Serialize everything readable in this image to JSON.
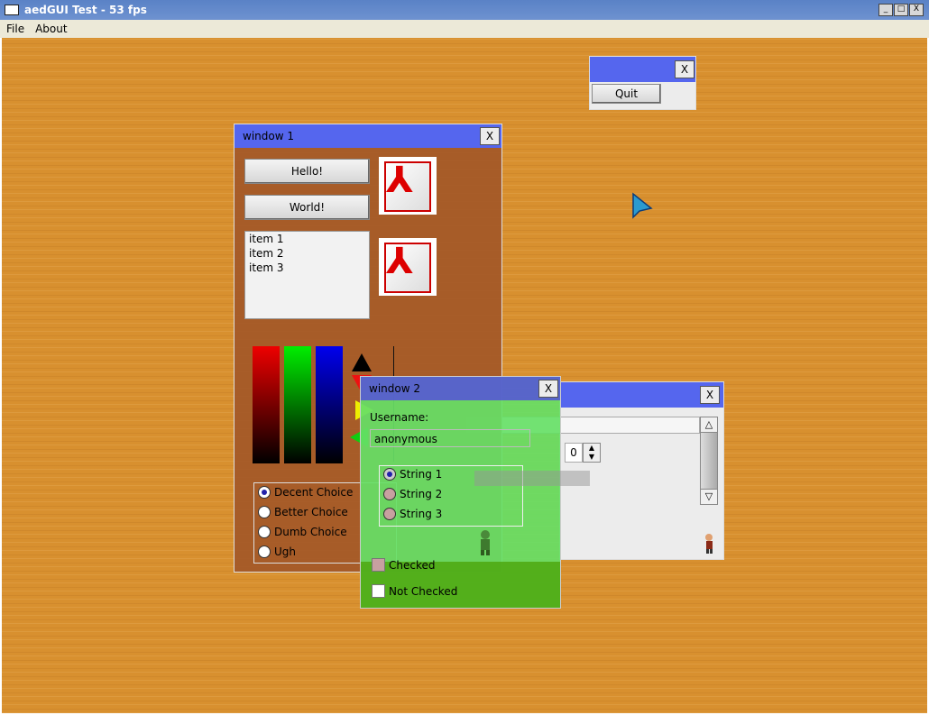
{
  "app": {
    "title": "aedGUI Test - 53 fps",
    "controls": [
      "_",
      "□",
      "X"
    ]
  },
  "menu": [
    "File",
    "About"
  ],
  "quit_window": {
    "close": "X",
    "quit": "Quit"
  },
  "window1": {
    "title": "window 1",
    "close": "X",
    "btn_hello": "Hello!",
    "btn_world": "World!",
    "list_items": [
      "item 1",
      "item 2",
      "item 3"
    ],
    "choices": [
      "Decent Choice",
      "Better Choice",
      "Dumb Choice",
      "Ugh"
    ],
    "selected_choice": 0
  },
  "window2": {
    "title": "window 2",
    "close": "X",
    "username_label": "Username:",
    "username_value": "anonymous",
    "strings": [
      "String 1",
      "String 2",
      "String 3"
    ],
    "selected_string": 0,
    "checked_label": "Checked",
    "not_checked_label": "Not Checked"
  },
  "window3": {
    "close": "X",
    "spin_value": "0",
    "spin_up": "▲",
    "spin_down": "▼",
    "scroll_up": "△",
    "scroll_down": "▽"
  },
  "colors": {
    "titlebar": "#5566ee",
    "desktop": "#d8902f",
    "window2_bg": "#66e066",
    "window1_bg": "#a45a28"
  }
}
